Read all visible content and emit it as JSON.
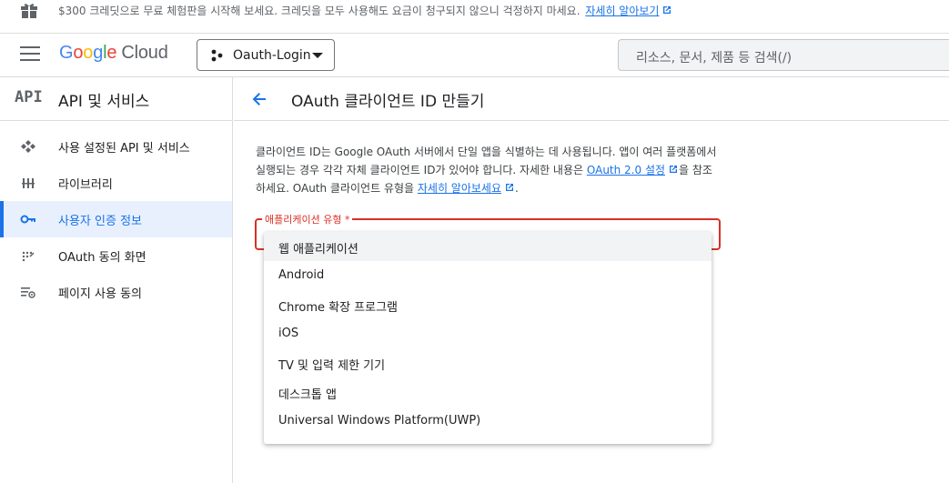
{
  "promo": {
    "text": "$300 크레딧으로 무료 체험판을 시작해 보세요. 크레딧을 모두 사용해도 요금이 청구되지 않으니 걱정하지 마세요.",
    "link": "자세히 알아보기"
  },
  "header": {
    "logo_google": [
      "G",
      "o",
      "o",
      "g",
      "l",
      "e"
    ],
    "logo_cloud": "Cloud",
    "project_name": "Oauth-Login",
    "search_placeholder": "리소스, 문서, 제품 등 검색(/)"
  },
  "sidebar": {
    "badge": "API",
    "title": "API 및 서비스",
    "items": [
      {
        "label": "사용 설정된 API 및 서비스",
        "icon": "api-hub-icon",
        "active": false
      },
      {
        "label": "라이브러리",
        "icon": "library-icon",
        "active": false
      },
      {
        "label": "사용자 인증 정보",
        "icon": "key-icon",
        "active": true
      },
      {
        "label": "OAuth 동의 화면",
        "icon": "consent-dots-icon",
        "active": false
      },
      {
        "label": "페이지 사용 동의",
        "icon": "settings-list-icon",
        "active": false
      }
    ]
  },
  "main": {
    "title": "OAuth 클라이언트 ID 만들기",
    "desc_part1": "클라이언트 ID는 Google OAuth 서버에서 단일 앱을 식별하는 데 사용됩니다. 앱이 여러 플랫폼에서 실행되는 경우 각각 자체 클라이언트 ID가 있어야 합니다. 자세한 내용은 ",
    "desc_link1": "OAuth 2.0 설정",
    "desc_part2": "을 참조하세요. OAuth 클라이언트 유형을 ",
    "desc_link2": "자세히 알아보세요",
    "desc_part3": ".",
    "select_label": "애플리케이션 유형 *",
    "options": [
      "웹 애플리케이션",
      "Android",
      "Chrome 확장 프로그램",
      "iOS",
      "TV 및 입력 제한 기기",
      "데스크톱 앱",
      "Universal Windows Platform(UWP)"
    ],
    "highlighted_option": "웹 애플리케이션"
  },
  "colors": {
    "accent": "#1a73e8",
    "error": "#d93025",
    "active_bg": "#e8f0fe"
  }
}
